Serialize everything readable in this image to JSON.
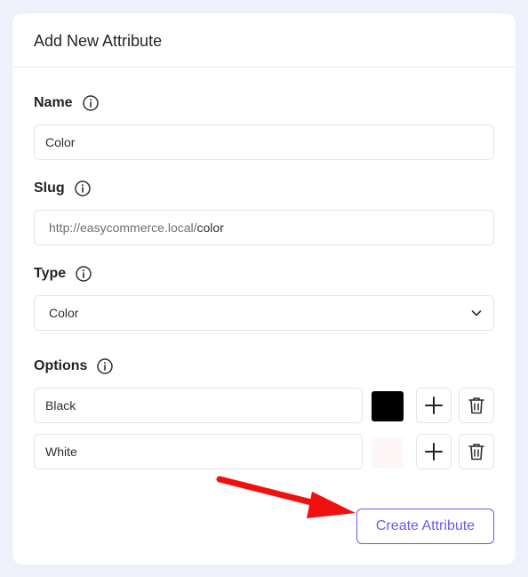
{
  "header": {
    "title": "Add New Attribute"
  },
  "name_field": {
    "label": "Name",
    "value": "Color"
  },
  "slug_field": {
    "label": "Slug",
    "prefix": "http://easycommerce.local/",
    "value": "color"
  },
  "type_field": {
    "label": "Type",
    "value": "Color"
  },
  "options": {
    "label": "Options",
    "items": [
      {
        "value": "Black",
        "color": "#000000"
      },
      {
        "value": "White",
        "color": "#fdf8f7"
      }
    ]
  },
  "actions": {
    "create_label": "Create Attribute"
  },
  "colors": {
    "accent": "#6f58e6",
    "annotation_arrow": "#f01010"
  }
}
